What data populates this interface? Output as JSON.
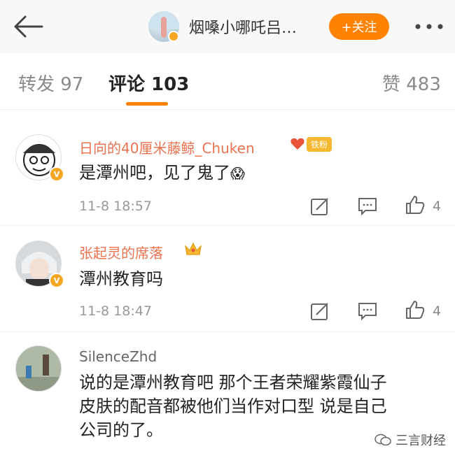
{
  "header": {
    "title": "烟嗓小哪吒吕…",
    "follow_label": "+关注",
    "accent_color": "#ff8200"
  },
  "tabs": {
    "repost": "转发 97",
    "comments": "评论 103",
    "likes": "赞 483"
  },
  "comments": [
    {
      "username": "日向的40厘米藤鲸_Chuken",
      "badge": "铁粉",
      "text": "是潭州吧，见了鬼了",
      "time": "11-8 18:57",
      "likes": "4"
    },
    {
      "username": "张起灵的席落",
      "text": "潭州教育吗",
      "time": "11-8 18:47",
      "likes": "4"
    },
    {
      "username": "SilenceZhd",
      "text_lines": [
        "说的是潭州教育吧 那个王者荣耀紫霞仙子",
        "皮肤的配音都被他们当作对口型 说是自己",
        "公司的了。"
      ]
    }
  ],
  "watermark": "三言财经",
  "icons": {
    "back": "arrow-left-icon",
    "more": "more-dots-icon",
    "repost": "repost-icon",
    "comment": "comment-icon",
    "like": "thumbs-up-icon"
  }
}
